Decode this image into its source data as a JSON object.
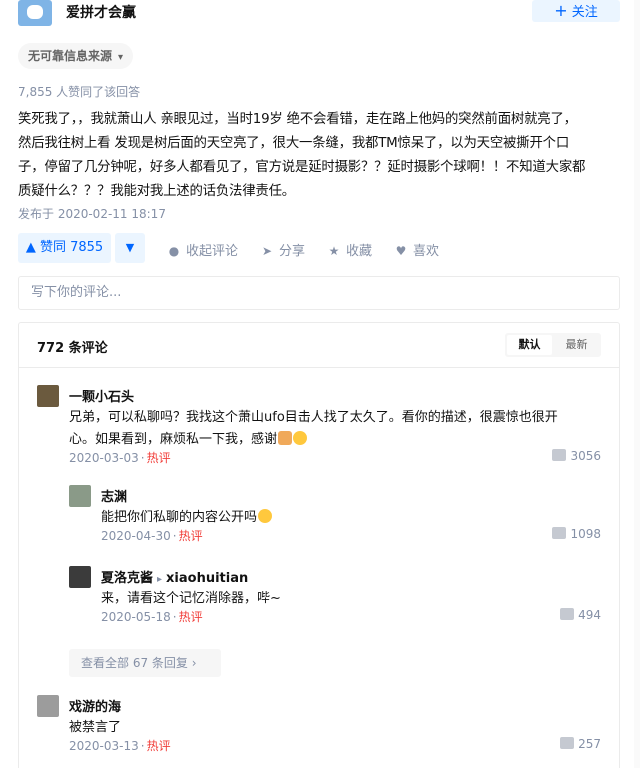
{
  "author": {
    "name": "爱拼才会赢",
    "follow_label": "关注"
  },
  "source_tag": {
    "label": "无可靠信息来源"
  },
  "likes_line": "7,855 人赞同了该回答",
  "answer": {
    "lines": [
      "笑死我了，，我就萧山人 亲眼见过，当时19岁 绝不会看错，走在路上他妈的突然前面树就亮了，",
      "然后我往树上看 发现是树后面的天空亮了，很大一条缝，我都TM惊呆了，以为天空被撕开个口",
      "子，停留了几分钟呢，好多人都看见了，官方说是延时摄影？？延时摄影个球啊！！不知道大家都",
      "质疑什么？？？我能对我上述的话负法律责任。"
    ],
    "published": "发布于 2020-02-11 18:17"
  },
  "actions": {
    "vote_up": "赞同 7855",
    "collapse_comments": "收起评论",
    "share": "分享",
    "favorite": "收藏",
    "like": "喜欢"
  },
  "comment_input": {
    "placeholder": "写下你的评论..."
  },
  "comments": {
    "count_label": "772 条评论",
    "sort": {
      "default": "默认",
      "latest": "最新"
    },
    "items": [
      {
        "user": "一颗小石头",
        "text_lines": [
          "兄弟，可以私聊吗？我找这个萧山ufo目击人找了太久了。看你的描述，很震惊也很开",
          "心。如果看到，麻烦私一下我，感谢"
        ],
        "date": "2020-03-03",
        "tag": "热评",
        "likes": "3056"
      },
      {
        "user": "志渊",
        "text_lines": [
          "能把你们私聊的内容公开吗"
        ],
        "date": "2020-04-30",
        "tag": "热评",
        "likes": "1098"
      },
      {
        "user": "夏洛克酱",
        "reply_to": "xiaohuitian",
        "text_lines": [
          "来，请看这个记忆消除器，哔~"
        ],
        "date": "2020-05-18",
        "tag": "热评",
        "likes": "494"
      },
      {
        "user": "戏游的海",
        "text_lines": [
          "被禁言了"
        ],
        "date": "2020-03-13",
        "tag": "热评",
        "likes": "257"
      }
    ],
    "view_all": "查看全部 67 条回复"
  },
  "colors": {
    "accent": "#0066ff",
    "hot": "#f1403c",
    "muted": "#8590a6"
  }
}
